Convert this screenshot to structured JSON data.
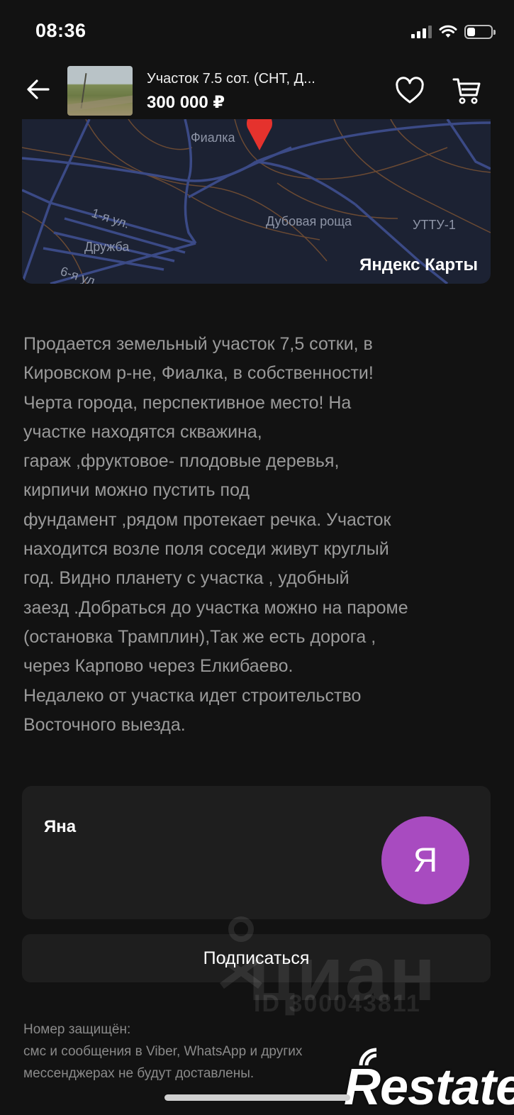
{
  "status_bar": {
    "time": "08:36",
    "signal_level": 0.75,
    "battery_level": 0.3
  },
  "header": {
    "title": "Участок 7.5 сот. (СНТ, Д...",
    "price": "300 000 ₽"
  },
  "map": {
    "labels": {
      "place": "Фиалка",
      "grove": "Дубовая роща",
      "utty": "УТТУ-1",
      "street_1": "1-я ул.",
      "druzhba": "Дружба",
      "street_6": "6-я ул."
    },
    "brand": "Яндекс Карты",
    "colors": {
      "background": "#1c2233",
      "roads": "#3b4a86",
      "paths": "#6b4a33",
      "pin": "#e5322d"
    }
  },
  "description": "Продается земельный участок 7,5 сотки, в\nКировском р-не, Фиалка, в собственности!\nЧерта города, перспективное место! На\nучастке находятся скважина,\nгараж ,фруктовое- плодовые деревья,\nкирпичи можно пустить под\nфундамент ,рядом протекает речка. Участок\nнаходится возле поля соседи живут круглый\nгод. Видно планету с участка , удобный\nзаезд .Добраться до участка можно на пароме\n(остановка Трамплин),Так же есть дорога ,\nчерез Карпово через Елкибаево.\nНедалеко от участка идет строительство\nВосточного выезда.",
  "seller": {
    "name": "Яна",
    "avatar_initial": "Я",
    "avatar_color": "#a84bc0"
  },
  "subscribe_label": "Подписаться",
  "watermark": {
    "brand": "циан",
    "id": "ID 300043811"
  },
  "notice": {
    "title": "Номер защищён:",
    "line1": "смс и сообщения в Viber, WhatsApp и других",
    "line2": "мессенджерах не будут доставлены."
  },
  "corner_logo": "Restate"
}
